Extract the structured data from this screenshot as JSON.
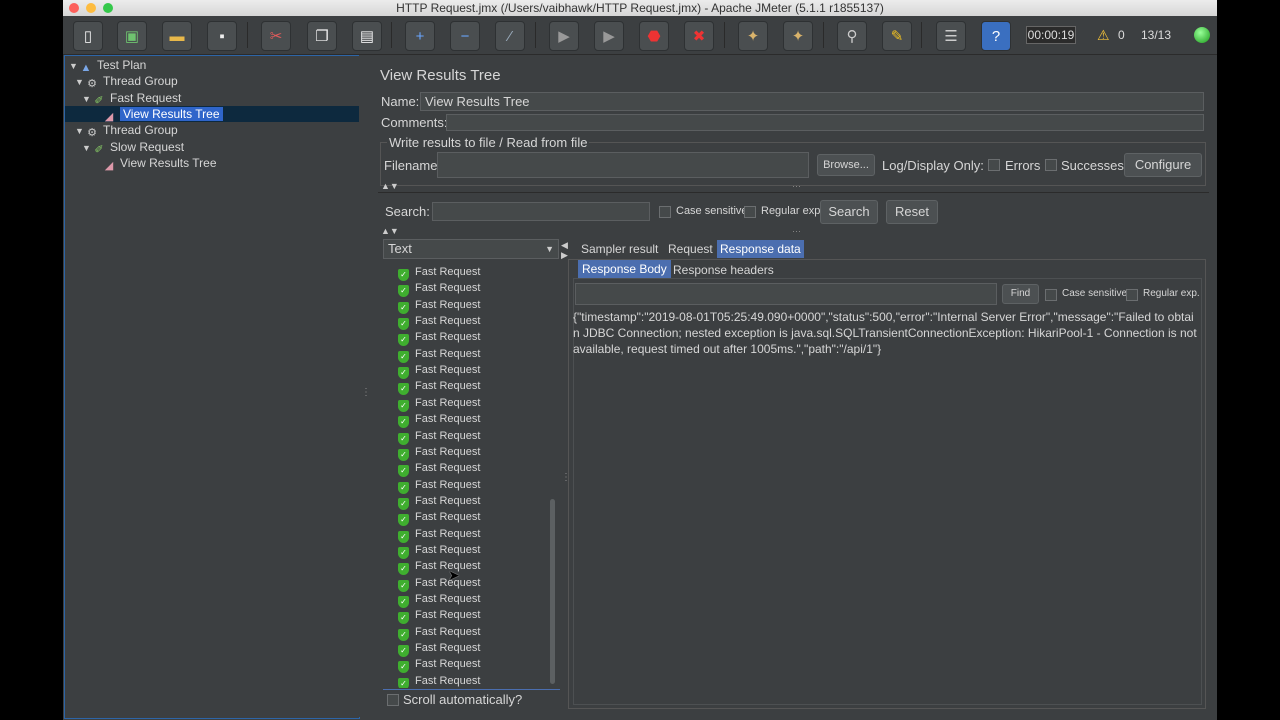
{
  "window": {
    "title": "HTTP Request.jmx (/Users/vaibhawk/HTTP Request.jmx) - Apache JMeter (5.1.1 r1855137)"
  },
  "toolbar": {
    "timer": "00:00:19",
    "warnings": "0",
    "threads": "13/13"
  },
  "tree": {
    "items": [
      {
        "label": "Test Plan"
      },
      {
        "label": "Thread Group"
      },
      {
        "label": "Fast Request"
      },
      {
        "label": "View Results Tree"
      },
      {
        "label": "Thread Group"
      },
      {
        "label": "Slow Request"
      },
      {
        "label": "View Results Tree"
      }
    ]
  },
  "panel": {
    "title": "View Results Tree",
    "name_label": "Name:",
    "name_value": "View Results Tree",
    "comments_label": "Comments:",
    "file_group_label": "Write results to file / Read from file",
    "filename_label": "Filename",
    "browse_label": "Browse...",
    "log_display_label": "Log/Display Only:",
    "errors_label": "Errors",
    "successes_label": "Successes",
    "configure_label": "Configure"
  },
  "search": {
    "label": "Search:",
    "case_sensitive": "Case sensitive",
    "regular_exp": "Regular exp.",
    "search_button": "Search",
    "reset_button": "Reset"
  },
  "results": {
    "renderer": "Text",
    "sample_label": "Fast Request",
    "sample_count": 26,
    "scroll_auto": "Scroll automatically?"
  },
  "tabs": {
    "sampler_result": "Sampler result",
    "request": "Request",
    "response_data": "Response data",
    "response_body": "Response Body",
    "response_headers": "Response headers",
    "find": "Find",
    "case_sensitive": "Case sensitive",
    "regular_exp": "Regular exp."
  },
  "response": {
    "body": "{\"timestamp\":\"2019-08-01T05:25:49.090+0000\",\"status\":500,\"error\":\"Internal Server Error\",\"message\":\"Failed to obtain JDBC Connection; nested exception is java.sql.SQLTransientConnectionException: HikariPool-1 - Connection is not available, request timed out after 1005ms.\",\"path\":\"/api/1\"}"
  }
}
